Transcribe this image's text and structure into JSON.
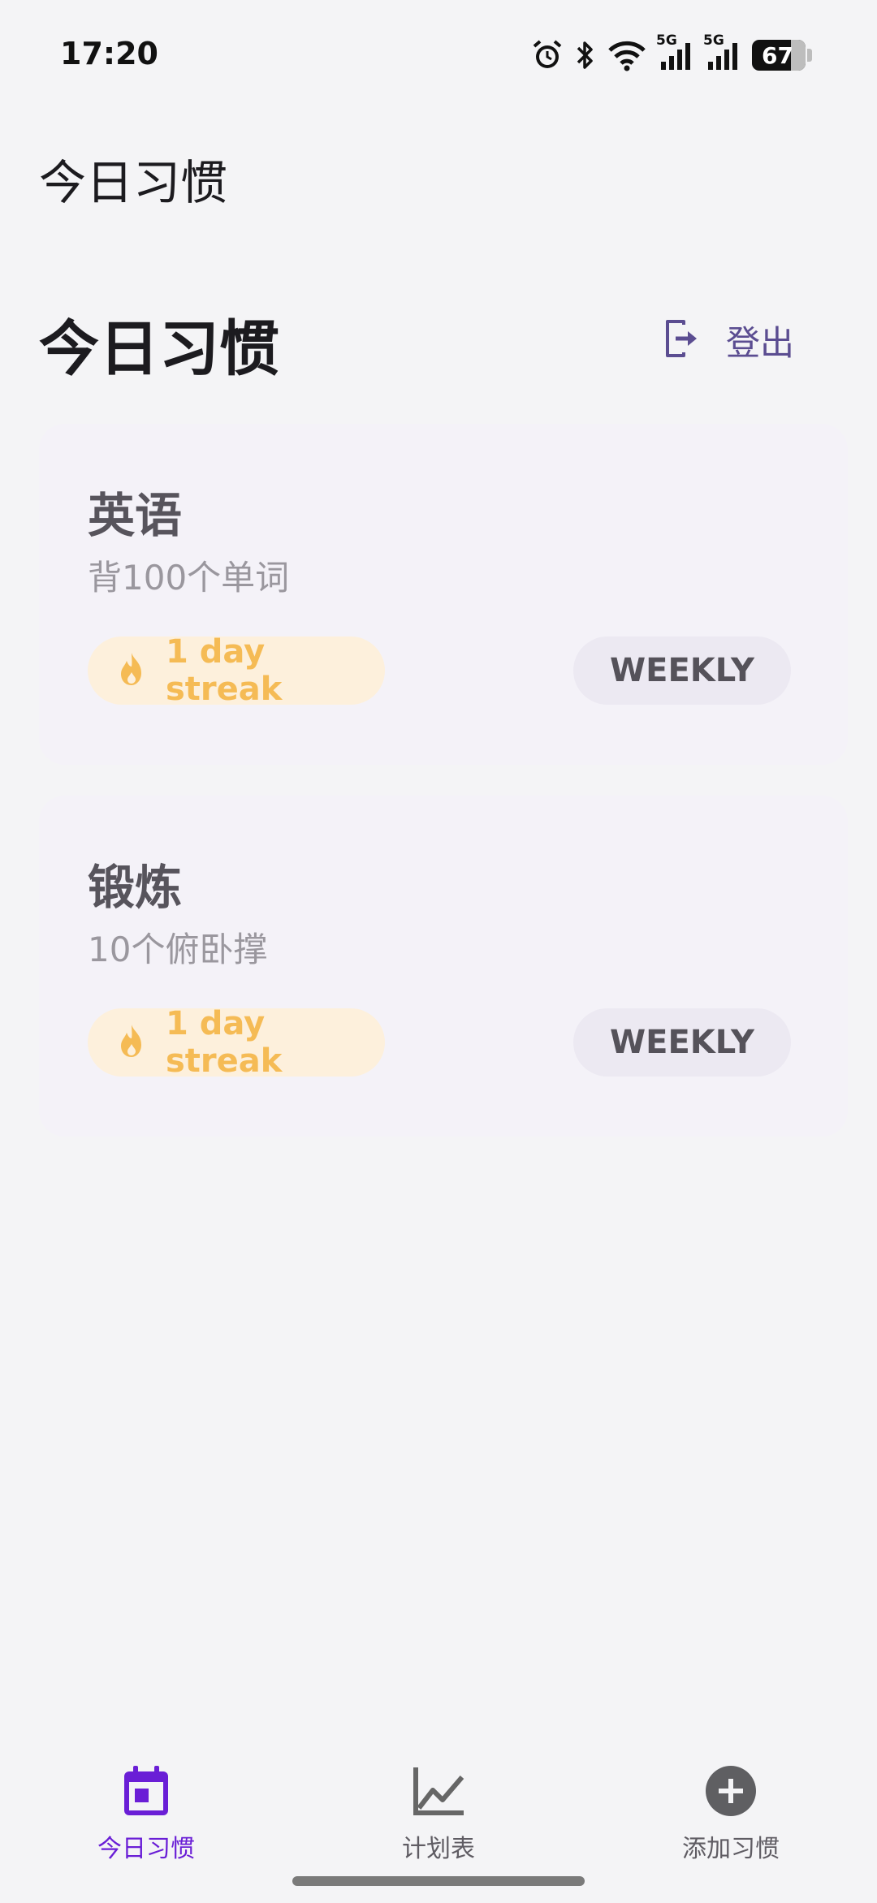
{
  "status_bar": {
    "time": "17:20",
    "icons": [
      "alarm-icon",
      "bluetooth-icon",
      "wifi-icon",
      "signal-5g-icon",
      "signal-5g-icon",
      "battery-icon"
    ],
    "network_label_1": "5G",
    "network_label_2": "5G",
    "battery_level": "67"
  },
  "app_bar": {
    "title": "今日习惯"
  },
  "header": {
    "title": "今日习惯",
    "logout_label": "登出",
    "logout_icon": "logout-icon"
  },
  "habits": [
    {
      "name": "英语",
      "description": "背100个单词",
      "streak": "1 day streak",
      "streak_icon": "fire-icon",
      "frequency": "WEEKLY"
    },
    {
      "name": "锻炼",
      "description": "10个俯卧撑",
      "streak": "1 day streak",
      "streak_icon": "fire-icon",
      "frequency": "WEEKLY"
    }
  ],
  "bottom_nav": {
    "items": [
      {
        "label": "今日习惯",
        "icon": "calendar-icon",
        "active": true
      },
      {
        "label": "计划表",
        "icon": "chart-line-icon",
        "active": false
      },
      {
        "label": "添加习惯",
        "icon": "add-circle-icon",
        "active": false
      }
    ]
  },
  "colors": {
    "accent": "#6a1ed6",
    "logout": "#5b4d91",
    "streak_text": "#f5bb55",
    "streak_bg": "#fdf0dc",
    "card_bg": "#f4f2f8"
  }
}
